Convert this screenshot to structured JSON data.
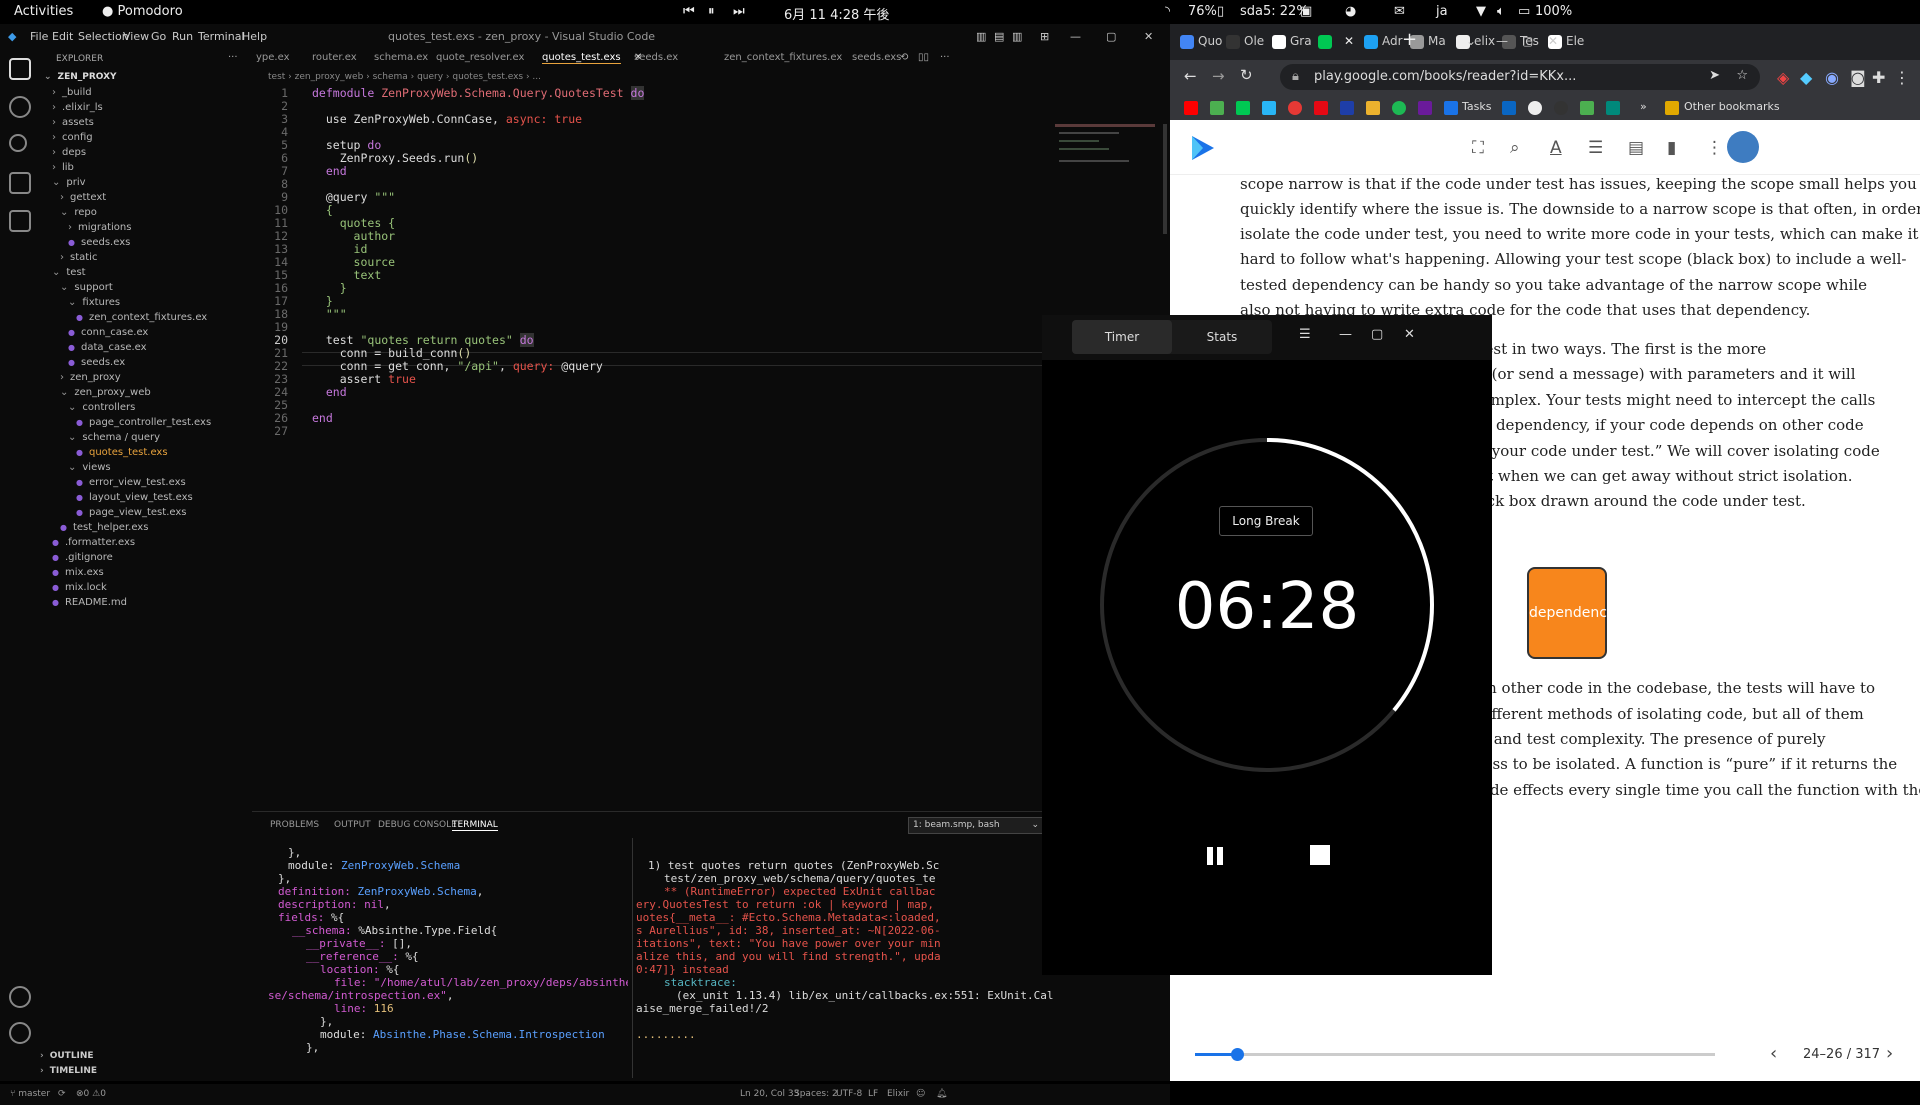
{
  "topbar": {
    "activities": "Activities",
    "app_name": "Pomodoro",
    "datetime": "6月 11  4:28 午後",
    "battery_label": "76%",
    "disk_label": "sda5: 22%",
    "input_method": "ja",
    "battery_percent": "100%"
  },
  "vscode": {
    "title": "quotes_test.exs - zen_proxy - Visual Studio Code",
    "menu": [
      "File",
      "Edit",
      "Selection",
      "View",
      "Go",
      "Run",
      "Terminal",
      "Help"
    ],
    "explorer_header": "EXPLORER",
    "tree": [
      {
        "label": "ZEN_PROXY",
        "kind": "open",
        "indent": 0
      },
      {
        "label": "_build",
        "kind": "dir",
        "indent": 1
      },
      {
        "label": ".elixir_ls",
        "kind": "dir",
        "indent": 1
      },
      {
        "label": "assets",
        "kind": "dir",
        "indent": 1
      },
      {
        "label": "config",
        "kind": "dir",
        "indent": 1
      },
      {
        "label": "deps",
        "kind": "dir",
        "indent": 1
      },
      {
        "label": "lib",
        "kind": "dir",
        "indent": 1
      },
      {
        "label": "priv",
        "kind": "open",
        "indent": 1
      },
      {
        "label": "gettext",
        "kind": "dir",
        "indent": 2
      },
      {
        "label": "repo",
        "kind": "open",
        "indent": 2
      },
      {
        "label": "migrations",
        "kind": "dir",
        "indent": 3
      },
      {
        "label": "seeds.exs",
        "kind": "file",
        "indent": 3
      },
      {
        "label": "static",
        "kind": "dir",
        "indent": 2
      },
      {
        "label": "test",
        "kind": "open",
        "indent": 1
      },
      {
        "label": "support",
        "kind": "open",
        "indent": 2
      },
      {
        "label": "fixtures",
        "kind": "open",
        "indent": 3
      },
      {
        "label": "zen_context_fixtures.ex",
        "kind": "file",
        "indent": 4
      },
      {
        "label": "conn_case.ex",
        "kind": "file",
        "indent": 3
      },
      {
        "label": "data_case.ex",
        "kind": "file",
        "indent": 3
      },
      {
        "label": "seeds.ex",
        "kind": "file",
        "indent": 3
      },
      {
        "label": "zen_proxy",
        "kind": "dir",
        "indent": 2
      },
      {
        "label": "zen_proxy_web",
        "kind": "open",
        "indent": 2
      },
      {
        "label": "controllers",
        "kind": "open",
        "indent": 3
      },
      {
        "label": "page_controller_test.exs",
        "kind": "file",
        "indent": 4
      },
      {
        "label": "schema / query",
        "kind": "open",
        "indent": 3
      },
      {
        "label": "quotes_test.exs",
        "kind": "file",
        "indent": 4
      },
      {
        "label": "views",
        "kind": "open",
        "indent": 3
      },
      {
        "label": "error_view_test.exs",
        "kind": "file",
        "indent": 4
      },
      {
        "label": "layout_view_test.exs",
        "kind": "file",
        "indent": 4
      },
      {
        "label": "page_view_test.exs",
        "kind": "file",
        "indent": 4
      },
      {
        "label": "test_helper.exs",
        "kind": "file",
        "indent": 2
      },
      {
        "label": ".formatter.exs",
        "kind": "file",
        "indent": 1
      },
      {
        "label": ".gitignore",
        "kind": "file",
        "indent": 1
      },
      {
        "label": "mix.exs",
        "kind": "file",
        "indent": 1
      },
      {
        "label": "mix.lock",
        "kind": "file",
        "indent": 1
      },
      {
        "label": "README.md",
        "kind": "file",
        "indent": 1
      }
    ],
    "outline": "OUTLINE",
    "timeline": "TIMELINE",
    "tabs": [
      "ype.ex",
      "router.ex",
      "schema.ex",
      "quote_resolver.ex",
      "quotes_test.exs",
      "seeds.ex",
      "zen_context_fixtures.ex",
      "seeds.exs"
    ],
    "active_tab": "quotes_test.exs",
    "breadcrumb": "test › zen_proxy_web › schema › query › quotes_test.exs › ...",
    "line_numbers": [
      "1",
      "2",
      "3",
      "4",
      "5",
      "6",
      "7",
      "8",
      "9",
      "10",
      "11",
      "12",
      "13",
      "14",
      "15",
      "16",
      "17",
      "18",
      "19",
      "20",
      "21",
      "22",
      "23",
      "24",
      "25",
      "26",
      "27"
    ],
    "panel_tabs": [
      "PROBLEMS",
      "OUTPUT",
      "DEBUG CONSOLE",
      "TERMINAL"
    ],
    "active_panel_tab": "TERMINAL",
    "terminal_select": "1: beam.smp, bash",
    "status": {
      "branch": "master",
      "errors": "0",
      "warnings": "0",
      "position": "Ln 20, Col 33",
      "spaces": "Spaces: 2",
      "encoding": "UTF-8",
      "eol": "LF",
      "language": "Elixir"
    }
  },
  "chrome": {
    "tabs": [
      "Quo",
      "Ole",
      "Gra",
      "",
      "Adr",
      "Ma",
      "elix",
      "Tes",
      "Ele"
    ],
    "url": "play.google.com/books/reader?id=KKx...",
    "bookmarks_tasks": "Tasks",
    "bookmarks_other": "Other bookmarks",
    "page_lines": [
      "scope narrow is that if the code under test has issues, keeping the scope small helps you",
      "quickly identify where the issue is. The downside to a narrow scope is that often, in order to",
      "isolate the code under test, you need to write more code in your tests, which can make it",
      "hard to follow what's happening. Allowing your test scope (black box) to include a well-",
      "tested dependency can be handy so you take advantage of the narrow scope while",
      "also not having to write extra code for the code that uses that dependency.",
      "You can isolate the code under test in two ways. The first is the more",
      "common one: you call a function (or send a message) with parameters and it will",
      "return a value. It can be more complex. Your tests might need to intercept the calls",
      "made by the code under test to a dependency, if your code depends on other code",
      "which we'll refer to as “isolating your code under test.” We will cover isolating code",
      "in later chapters, but first look at when we can get away without strict isolation.",
      "Think of your test scope as a black box drawn around the code under test.",
      "If the code under test depends on other code in the codebase, the tests will have to",
      "account for it. There are many different methods of isolating code, but all of them",
      "come at a cost of additional time and test complexity. The presence of purely",
      "functional code means there is less to be isolated. A function is “pure” if it returns the",
      "exact same answer and has no side effects every single time you call the function with the"
    ],
    "dependency_box": "dependency",
    "page_indicator": "24–26 / 317",
    "progress": 0.08
  },
  "pomodoro": {
    "tabs": [
      "Timer",
      "Stats"
    ],
    "active_tab": "Timer",
    "mode": "Long Break",
    "time": "06:28",
    "progress": 0.36
  },
  "colors": {
    "accent": "#1a73e8",
    "dependency_orange": "#f7861c",
    "elixir_purple": "#8a5cd6"
  }
}
